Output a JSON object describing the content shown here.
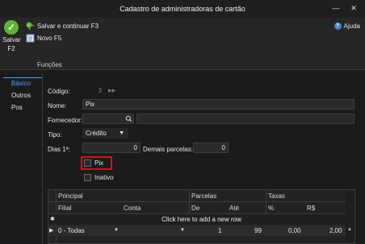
{
  "window": {
    "title": "Cadastro de administradoras de cartão",
    "minimize": "—",
    "close": "✕"
  },
  "ribbon": {
    "save_label_1": "Salvar",
    "save_label_2": "F2",
    "save_continue_label": "Salvar e continuar F3",
    "new_label": "Novo F5",
    "group_label": "Funções",
    "help_label": "Ajuda",
    "help_glyph": "?"
  },
  "nav": {
    "items": [
      "Básico",
      "Outros",
      "Pos"
    ]
  },
  "form": {
    "codigo_label": "Código:",
    "codigo_value": "3",
    "codigo_arrow": "▶▶",
    "nome_label": "Nome:",
    "nome_value": "Pix",
    "fornecedor_label": "Fornecedor:",
    "fornecedor_value": "",
    "fornecedor_desc": "",
    "tipo_label": "Tipo:",
    "tipo_value": "Crédito",
    "dias_label": "Dias 1ª:",
    "dias_value": "0",
    "demais_label": "Demais parcelas:",
    "demais_value": "0",
    "pix_label": "Pix",
    "pix_checked": false,
    "inativo_label": "Inativo",
    "inativo_checked": false
  },
  "grid": {
    "group_headers": [
      "Principal",
      "Parcelas",
      "Taxas"
    ],
    "columns": [
      "Filial",
      "Conta",
      "De",
      "Até",
      "%",
      "R$"
    ],
    "add_row_text": "Click here to add a new row",
    "rows": [
      {
        "filial": "0 - Todas",
        "conta": "",
        "de": "1",
        "ate": "99",
        "pct": "0,00",
        "rs": "2,00"
      }
    ]
  },
  "colors": {
    "accent": "#4aa3ff",
    "save_green": "#5cb531",
    "highlight_red": "#d0141a"
  }
}
